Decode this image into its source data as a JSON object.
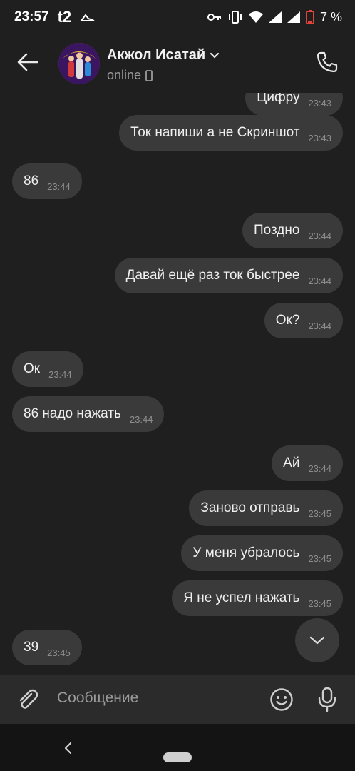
{
  "status_bar": {
    "time": "23:57",
    "carrier": "t2",
    "battery_percent": "7 %"
  },
  "header": {
    "contact_name": "Акжол Исатай",
    "status": "online"
  },
  "messages": [
    {
      "text": "Цифру",
      "time": "23:43",
      "direction": "out"
    },
    {
      "text": "Ток напиши а не Скриншот",
      "time": "23:43",
      "direction": "out"
    },
    {
      "text": "86",
      "time": "23:44",
      "direction": "in"
    },
    {
      "text": "Поздно",
      "time": "23:44",
      "direction": "out"
    },
    {
      "text": "Давай ещё раз ток быстрее",
      "time": "23:44",
      "direction": "out"
    },
    {
      "text": "Ок?",
      "time": "23:44",
      "direction": "out"
    },
    {
      "text": "Ок",
      "time": "23:44",
      "direction": "in"
    },
    {
      "text": "86 надо нажать",
      "time": "23:44",
      "direction": "in"
    },
    {
      "text": "Ай",
      "time": "23:44",
      "direction": "out"
    },
    {
      "text": "Заново отправь",
      "time": "23:45",
      "direction": "out"
    },
    {
      "text": "У меня убралось",
      "time": "23:45",
      "direction": "out"
    },
    {
      "text": "Я не успел нажать",
      "time": "23:45",
      "direction": "out"
    },
    {
      "text": "39",
      "time": "23:45",
      "direction": "in"
    }
  ],
  "composer": {
    "placeholder": "Сообщение"
  },
  "colors": {
    "background": "#1f1f1f",
    "bubble": "#3a3a3a",
    "battery_low": "#e0443a"
  }
}
